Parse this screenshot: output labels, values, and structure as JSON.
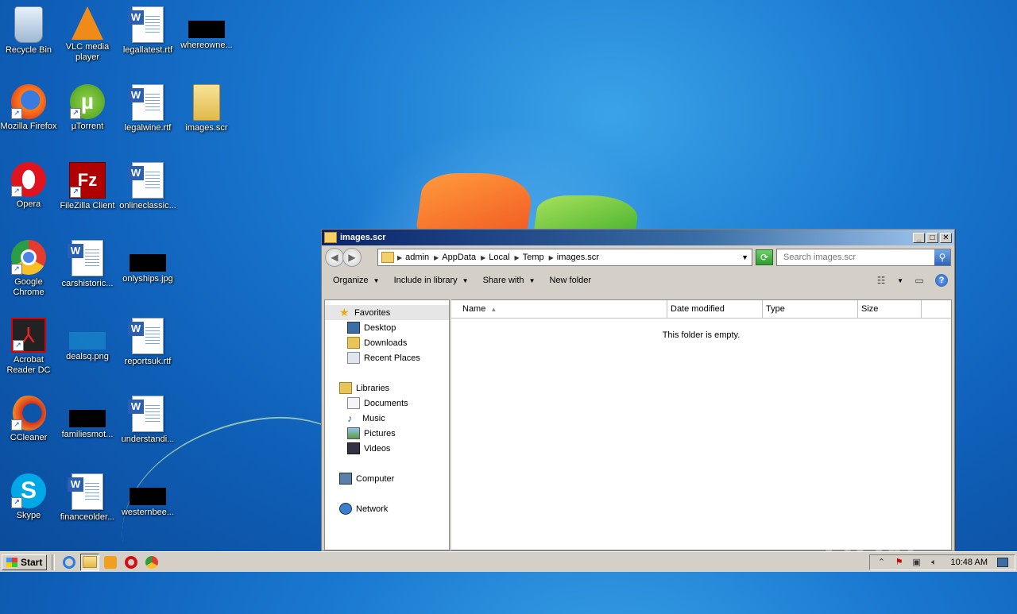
{
  "desktop": {
    "icons": [
      {
        "label": "Recycle Bin",
        "icon": "recycle-bin-icon"
      },
      {
        "label": "VLC media player",
        "icon": "vlc-icon"
      },
      {
        "label": "legallatest.rtf",
        "icon": "word-doc-icon"
      },
      {
        "label": "whereowne...",
        "icon": "black-thumbnail-icon"
      },
      {
        "label": "Mozilla Firefox",
        "icon": "firefox-icon"
      },
      {
        "label": "µTorrent",
        "icon": "utorrent-icon"
      },
      {
        "label": "legalwine.rtf",
        "icon": "word-doc-icon"
      },
      {
        "label": "images.scr",
        "icon": "folder-icon"
      },
      {
        "label": "Opera",
        "icon": "opera-icon"
      },
      {
        "label": "FileZilla Client",
        "icon": "filezilla-icon"
      },
      {
        "label": "onlineclassic...",
        "icon": "word-doc-icon"
      },
      {
        "label": "Google Chrome",
        "icon": "chrome-icon"
      },
      {
        "label": "carshistoric...",
        "icon": "word-doc-icon"
      },
      {
        "label": "onlyships.jpg",
        "icon": "black-thumbnail-icon"
      },
      {
        "label": "Acrobat Reader DC",
        "icon": "acrobat-icon"
      },
      {
        "label": "dealsq.png",
        "icon": "image-thumbnail-icon"
      },
      {
        "label": "reportsuk.rtf",
        "icon": "word-doc-icon"
      },
      {
        "label": "CCleaner",
        "icon": "ccleaner-icon"
      },
      {
        "label": "familiesmot...",
        "icon": "black-thumbnail-icon"
      },
      {
        "label": "understandi...",
        "icon": "word-doc-icon"
      },
      {
        "label": "Skype",
        "icon": "skype-icon"
      },
      {
        "label": "financeolder...",
        "icon": "word-doc-icon"
      },
      {
        "label": "westernbee...",
        "icon": "black-thumbnail-icon"
      }
    ]
  },
  "explorer": {
    "title": "images.scr",
    "breadcrumb": [
      "admin",
      "AppData",
      "Local",
      "Temp",
      "images.scr"
    ],
    "search_placeholder": "Search images.scr",
    "commands": {
      "organize": "Organize",
      "include_in_library": "Include in library",
      "share_with": "Share with",
      "new_folder": "New folder"
    },
    "nav": {
      "favorites": "Favorites",
      "desktop": "Desktop",
      "downloads": "Downloads",
      "recent_places": "Recent Places",
      "libraries": "Libraries",
      "documents": "Documents",
      "music": "Music",
      "pictures": "Pictures",
      "videos": "Videos",
      "computer": "Computer",
      "network": "Network"
    },
    "columns": {
      "name": "Name",
      "date_modified": "Date modified",
      "type": "Type",
      "size": "Size"
    },
    "empty_message": "This folder is empty."
  },
  "watermark": "ANY RUN",
  "taskbar": {
    "start_label": "Start",
    "clock": "10:48 AM"
  }
}
